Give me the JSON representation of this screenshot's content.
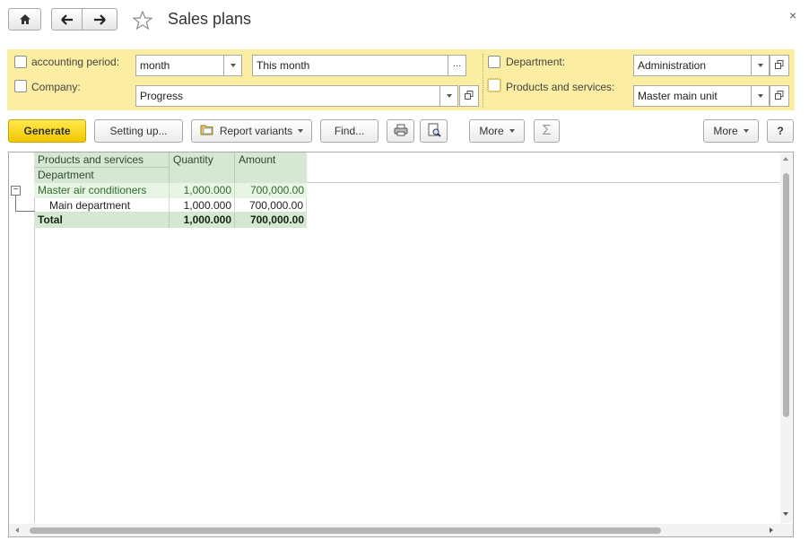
{
  "window": {
    "title": "Sales plans",
    "close_symbol": "×"
  },
  "nav": {
    "home_icon": "home-icon",
    "back_icon": "arrow-left-icon",
    "forward_icon": "arrow-right-icon",
    "favorite_icon": "star-icon"
  },
  "filters": {
    "accounting_period": {
      "label": "accounting period:",
      "checked": false,
      "period_value": "month",
      "range_value": "This month",
      "range_button": "..."
    },
    "company": {
      "label": "Company:",
      "checked": false,
      "value": "Progress"
    },
    "department": {
      "label": "Department:",
      "checked": false,
      "value": "Administration"
    },
    "products": {
      "label": "Products and services:",
      "checked": false,
      "value": "Master main unit"
    }
  },
  "toolbar": {
    "generate_label": "Generate",
    "setting_up_label": "Setting up...",
    "report_variants_label": "Report variants",
    "find_label": "Find...",
    "more_label": "More",
    "sum_symbol": "Σ",
    "more_right_label": "More",
    "help_label": "?"
  },
  "report": {
    "headers": {
      "products": "Products and services",
      "department": "Department",
      "quantity": "Quantity",
      "amount": "Amount"
    },
    "group_row": {
      "name": "Master air conditioners",
      "quantity": "1,000.000",
      "amount": "700,000.00",
      "toggle": "−"
    },
    "detail_row": {
      "name": "Main department",
      "quantity": "1,000.000",
      "amount": "700,000.00"
    },
    "total_row": {
      "name": "Total",
      "quantity": "1,000.000",
      "amount": "700,000.00"
    }
  },
  "colors": {
    "filter_panel": "#fbeda2",
    "generate_button": "#f5d000",
    "header_fill": "#d6e8d4",
    "group_text": "#2e6b2c"
  }
}
